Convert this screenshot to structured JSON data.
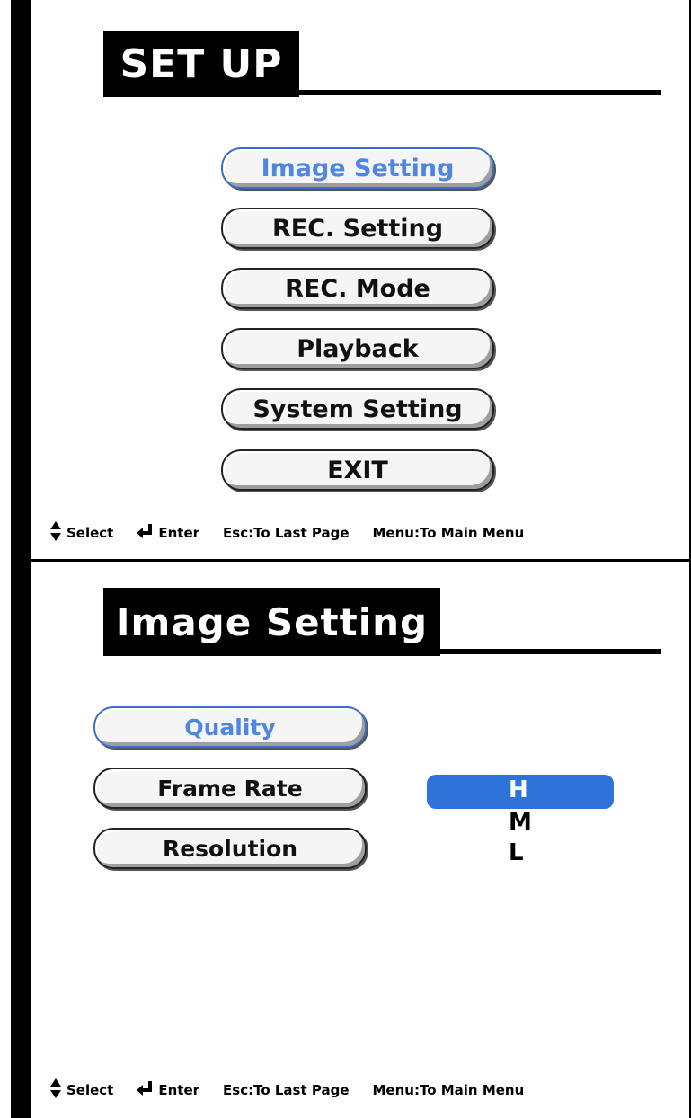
{
  "setup": {
    "title": "SET UP",
    "menu": [
      {
        "label": "Image Setting",
        "selected": true
      },
      {
        "label": "REC. Setting",
        "selected": false
      },
      {
        "label": "REC. Mode",
        "selected": false
      },
      {
        "label": "Playback",
        "selected": false
      },
      {
        "label": "System Setting",
        "selected": false
      },
      {
        "label": "EXIT",
        "selected": false
      }
    ],
    "footer": {
      "select": "Select",
      "enter": "Enter",
      "esc": "Esc:To Last Page",
      "menu": "Menu:To Main Menu"
    }
  },
  "image_setting": {
    "title": "Image Setting",
    "menu": [
      {
        "label": "Quality",
        "selected": true
      },
      {
        "label": "Frame Rate",
        "selected": false
      },
      {
        "label": "Resolution",
        "selected": false
      }
    ],
    "options": [
      {
        "label": "H",
        "selected": true
      },
      {
        "label": "M",
        "selected": false
      },
      {
        "label": "L",
        "selected": false
      }
    ],
    "footer": {
      "select": "Select",
      "enter": "Enter",
      "esc": "Esc:To Last Page",
      "menu": "Menu:To Main Menu"
    }
  },
  "colors": {
    "selected_text": "#4f86e0",
    "selected_option_bg": "#2e74d8",
    "title_bg": "#000000"
  }
}
